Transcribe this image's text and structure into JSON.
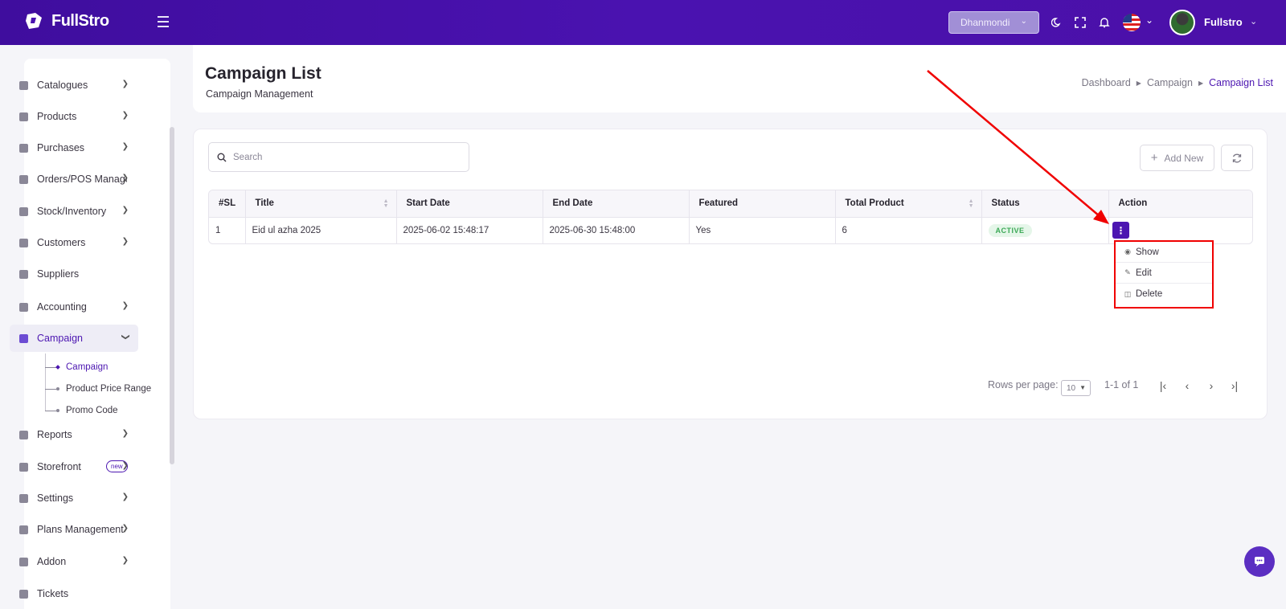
{
  "header": {
    "brand": "FullStro",
    "branch": "Dhanmondi",
    "user_name": "Fullstro"
  },
  "sidebar": {
    "items": [
      {
        "label": "Catalogues"
      },
      {
        "label": "Products"
      },
      {
        "label": "Purchases"
      },
      {
        "label": "Orders/POS Management"
      },
      {
        "label": "Stock/Inventory"
      },
      {
        "label": "Customers"
      },
      {
        "label": "Suppliers"
      },
      {
        "label": "Accounting"
      },
      {
        "label": "Campaign"
      },
      {
        "label": "Reports"
      },
      {
        "label": "Storefront"
      },
      {
        "label": "Settings"
      },
      {
        "label": "Plans Management"
      },
      {
        "label": "Addon"
      },
      {
        "label": "Tickets"
      }
    ],
    "campaign_sub": [
      {
        "label": "Campaign"
      },
      {
        "label": "Product Price Range"
      },
      {
        "label": "Promo Code"
      }
    ],
    "new_badge": "new"
  },
  "page": {
    "title": "Campaign List",
    "subtitle": "Campaign Management",
    "breadcrumb": [
      "Dashboard",
      "Campaign",
      "Campaign List"
    ]
  },
  "toolbar": {
    "search_placeholder": "Search",
    "add_label": "Add New"
  },
  "table": {
    "headers": [
      "#SL",
      "Title",
      "Start Date",
      "End Date",
      "Featured",
      "Total Product",
      "Status",
      "Action"
    ],
    "rows": [
      {
        "sl": "1",
        "title": "Eid ul azha 2025",
        "start": "2025-06-02 15:48:17",
        "end": "2025-06-30 15:48:00",
        "featured": "Yes",
        "total": "6",
        "status": "ACTIVE"
      }
    ]
  },
  "action_menu": {
    "items": [
      "Show",
      "Edit",
      "Delete"
    ]
  },
  "pagination": {
    "rows_per_page_label": "Rows per page:",
    "rows_per_page": "10",
    "range": "1-1 of 1"
  },
  "colors": {
    "primary": "#4c16b1",
    "annotation": "#f00000",
    "status_active": "#3aa855"
  }
}
